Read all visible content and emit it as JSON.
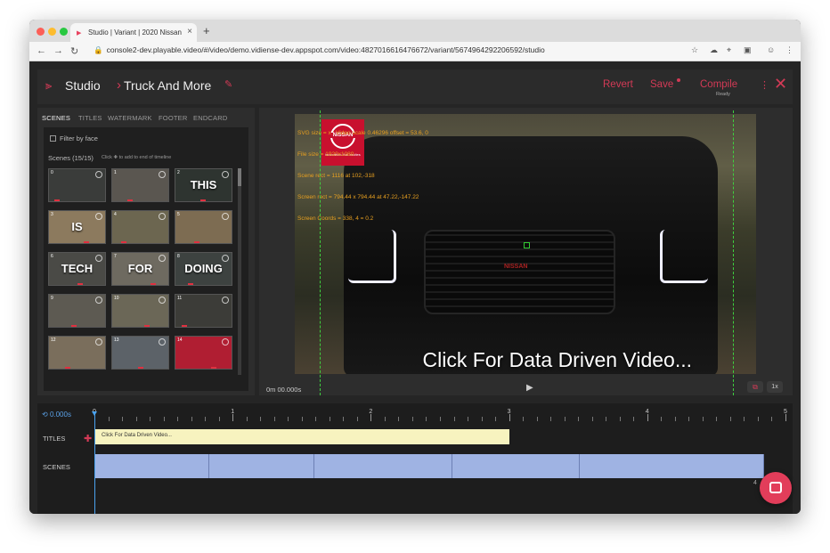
{
  "browser": {
    "tab_title": "Studio | Variant | 2020 Nissan",
    "url": "console2-dev.playable.video/#/video/demo.vidiense-dev.appspot.com/video:4827016616476672/variant/5674964292206592/studio"
  },
  "header": {
    "breadcrumb_root": "Studio",
    "breadcrumb_current": "Truck And More",
    "revert_label": "Revert",
    "save_label": "Save",
    "compile_label": "Compile",
    "compile_status": "Ready"
  },
  "left_panel": {
    "tabs": [
      "SCENES",
      "TITLES",
      "WATERMARK",
      "FOOTER",
      "ENDCARD"
    ],
    "active_tab": "SCENES",
    "filter_label": "Filter by face",
    "scenes_title": "Scenes (15/15)",
    "scenes_hint": "Click ✚ to add to end of timeline",
    "scenes": [
      {
        "num": "0",
        "word": ""
      },
      {
        "num": "1",
        "word": ""
      },
      {
        "num": "2",
        "word": "THIS"
      },
      {
        "num": "3",
        "word": "IS"
      },
      {
        "num": "4",
        "word": ""
      },
      {
        "num": "5",
        "word": ""
      },
      {
        "num": "6",
        "word": "TECH"
      },
      {
        "num": "7",
        "word": "FOR"
      },
      {
        "num": "8",
        "word": "DOING"
      },
      {
        "num": "9",
        "word": ""
      },
      {
        "num": "10",
        "word": ""
      },
      {
        "num": "11",
        "word": ""
      },
      {
        "num": "12",
        "word": ""
      },
      {
        "num": "13",
        "word": ""
      },
      {
        "num": "14",
        "word": ""
      }
    ]
  },
  "preview": {
    "debug": [
      "SVG size = x : Video scale 0.46296 offset = 53.6, 0",
      "File size = 1920x1080",
      "Scene rect = 1116 at 102,-318",
      "Screen rect = 794.44 x 794.44 at 47.22,-147.22",
      "Screen Coords = 338, 4 = 0.2"
    ],
    "brand_name": "NISSAN",
    "brand_tagline": "innovation that excites",
    "caption": "Click For Data Driven Video...",
    "time": "0m 00.000s",
    "speed": "1x"
  },
  "timeline": {
    "loop_time": "0.000s",
    "ruler_labels": [
      "0",
      "1",
      "2",
      "3",
      "4",
      "5"
    ],
    "titles_label": "TITLES",
    "scenes_label": "SCENES",
    "title_clip_text": "Click For Data Driven Video...",
    "end_marker": "4"
  },
  "colors": {
    "accent": "#d33a56",
    "title_clip": "#f7f3bf",
    "scene_clip": "#9fb3e3",
    "playhead": "#4aa3f0",
    "guide": "#3fd03f"
  }
}
